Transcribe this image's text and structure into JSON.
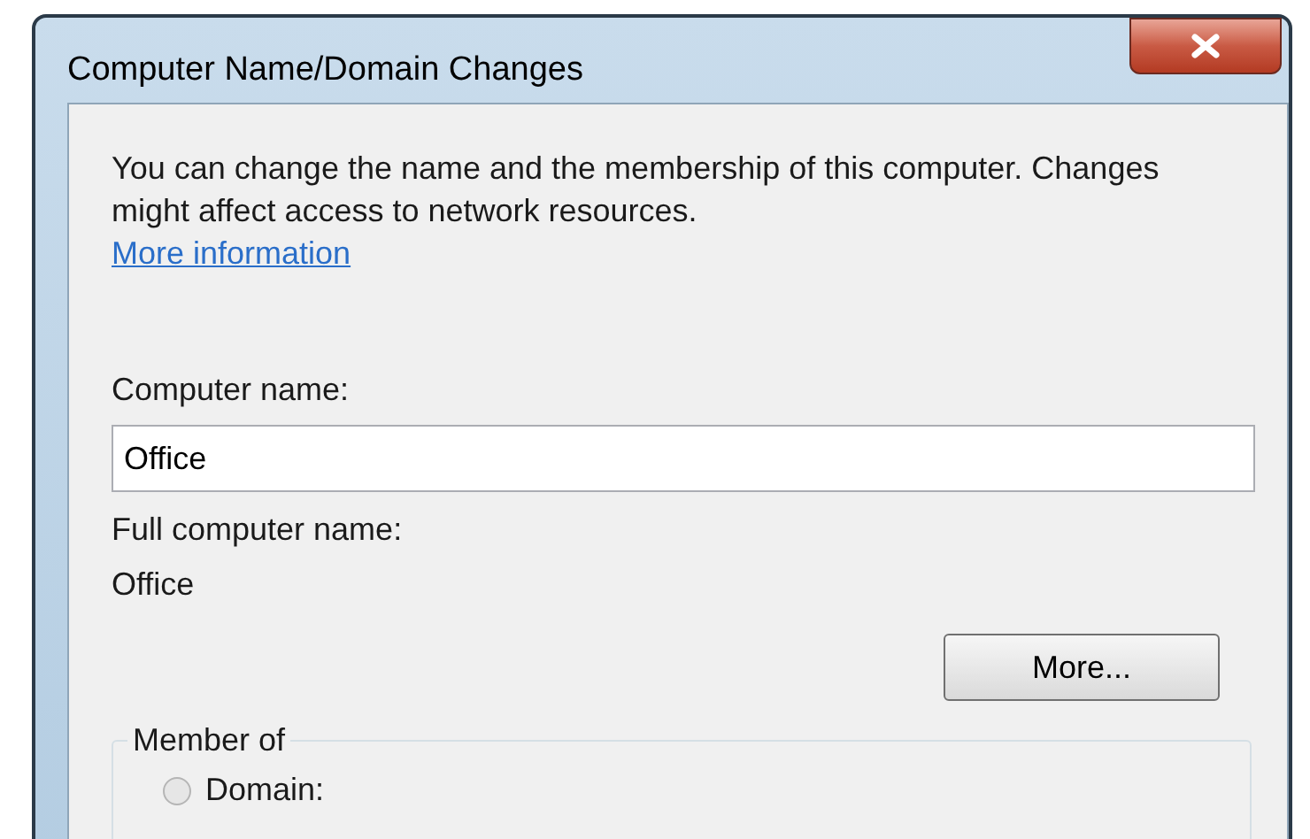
{
  "window": {
    "title": "Computer Name/Domain Changes"
  },
  "description": "You can change the name and the membership of this computer. Changes might affect access to network resources.",
  "link": "More information",
  "computer_name": {
    "label": "Computer name:",
    "value": "Office"
  },
  "full_computer_name": {
    "label": "Full computer name:",
    "value": "Office"
  },
  "more_button": "More...",
  "member_of": {
    "title": "Member of",
    "options": [
      {
        "label": "Domain:",
        "selected": false
      }
    ]
  }
}
